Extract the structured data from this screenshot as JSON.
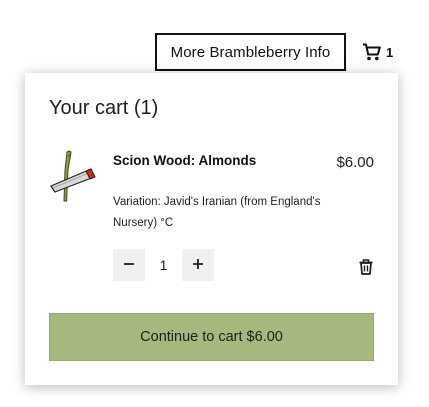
{
  "header": {
    "info_button_label": "More Brambleberry Info",
    "cart_count": "1",
    "cart_icon": "cart-icon"
  },
  "cart_panel": {
    "title": "Your cart (1)",
    "items": [
      {
        "name": "Scion Wood: Almonds",
        "price": "$6.00",
        "variation": "Variation: Javid's Iranian (from England's Nursery) °C",
        "quantity": "1",
        "image_icon": "scion-wood-icon"
      }
    ],
    "decrease_icon": "minus-icon",
    "increase_icon": "plus-icon",
    "remove_icon": "trash-icon",
    "checkout_label": "Continue to cart $6.00",
    "checkout_color": "#a5b97e"
  }
}
